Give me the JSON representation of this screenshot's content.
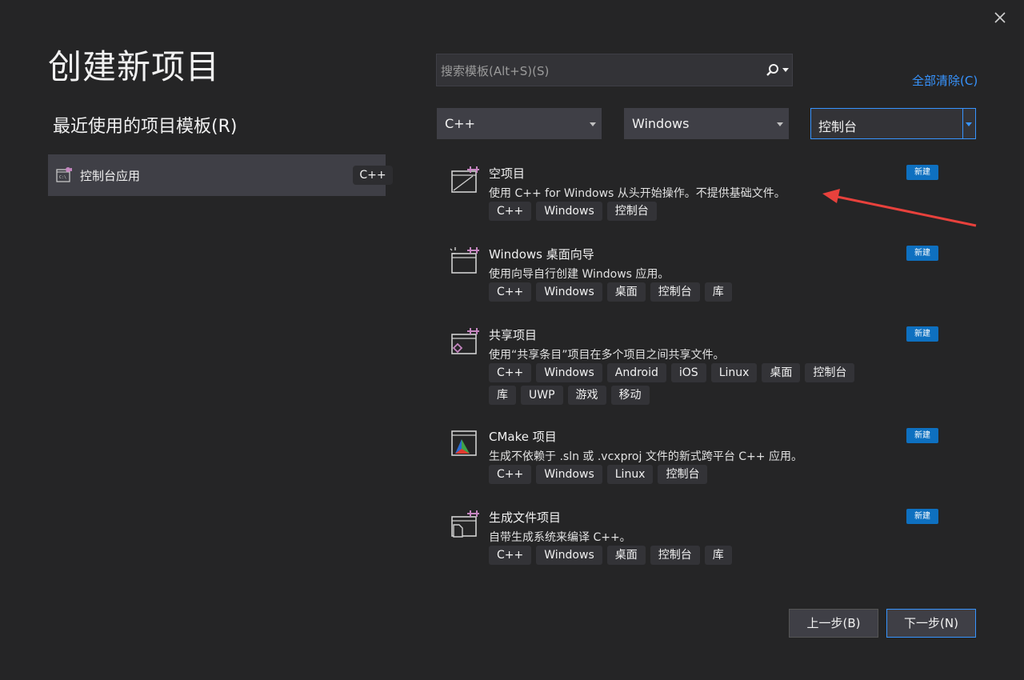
{
  "window": {
    "title": "创建新项目"
  },
  "recent": {
    "heading": "最近使用的项目模板(R)",
    "items": [
      {
        "label": "控制台应用",
        "tag": "C++"
      }
    ]
  },
  "search": {
    "placeholder": "搜索模板(Alt+S)(S)"
  },
  "filters": {
    "clear_all": "全部清除(C)",
    "language": "C++",
    "platform": "Windows",
    "project_type": "控制台"
  },
  "projects": [
    {
      "name": "空项目",
      "description": "使用 C++ for Windows 从头开始操作。不提供基础文件。",
      "badge": "新建",
      "tags": [
        "C++",
        "Windows",
        "控制台"
      ]
    },
    {
      "name": "Windows 桌面向导",
      "description": "使用向导自行创建 Windows 应用。",
      "badge": "新建",
      "tags": [
        "C++",
        "Windows",
        "桌面",
        "控制台",
        "库"
      ]
    },
    {
      "name": "共享项目",
      "description": "使用“共享条目”项目在多个项目之间共享文件。",
      "badge": "新建",
      "tags": [
        "C++",
        "Windows",
        "Android",
        "iOS",
        "Linux",
        "桌面",
        "控制台",
        "库",
        "UWP",
        "游戏",
        "移动"
      ]
    },
    {
      "name": "CMake 项目",
      "description": "生成不依赖于 .sln 或 .vcxproj 文件的新式跨平台 C++ 应用。",
      "badge": "新建",
      "tags": [
        "C++",
        "Windows",
        "Linux",
        "控制台"
      ]
    },
    {
      "name": "生成文件项目",
      "description": "自带生成系统来编译 C++。",
      "badge": "新建",
      "tags": [
        "C++",
        "Windows",
        "桌面",
        "控制台",
        "库"
      ]
    }
  ],
  "buttons": {
    "back": "上一步(B)",
    "next": "下一步(N)"
  },
  "colors": {
    "accent": "#3794ff",
    "badge": "#0e70c0",
    "annotation_arrow": "#e8413c",
    "background": "#252526"
  }
}
